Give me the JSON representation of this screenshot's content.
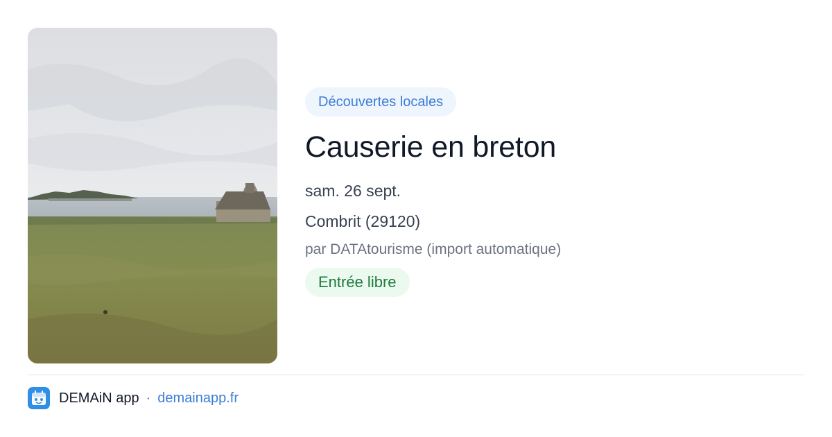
{
  "event": {
    "category": "Découvertes locales",
    "title": "Causerie en breton",
    "date": "sam. 26 sept.",
    "location": "Combrit (29120)",
    "organizer": "par DATAtourisme (import automatique)",
    "price": "Entrée libre"
  },
  "footer": {
    "app_name": "DEMAiN app",
    "separator": "·",
    "link": "demainapp.fr"
  },
  "image": {
    "description_icon": "photo-coastal-landscape"
  },
  "colors": {
    "category_bg": "#eef5fd",
    "category_text": "#3b7dd8",
    "price_bg": "#ebf9ef",
    "price_text": "#1e7b3c",
    "link": "#3b7dd8",
    "logo": "#2f8fe8"
  }
}
